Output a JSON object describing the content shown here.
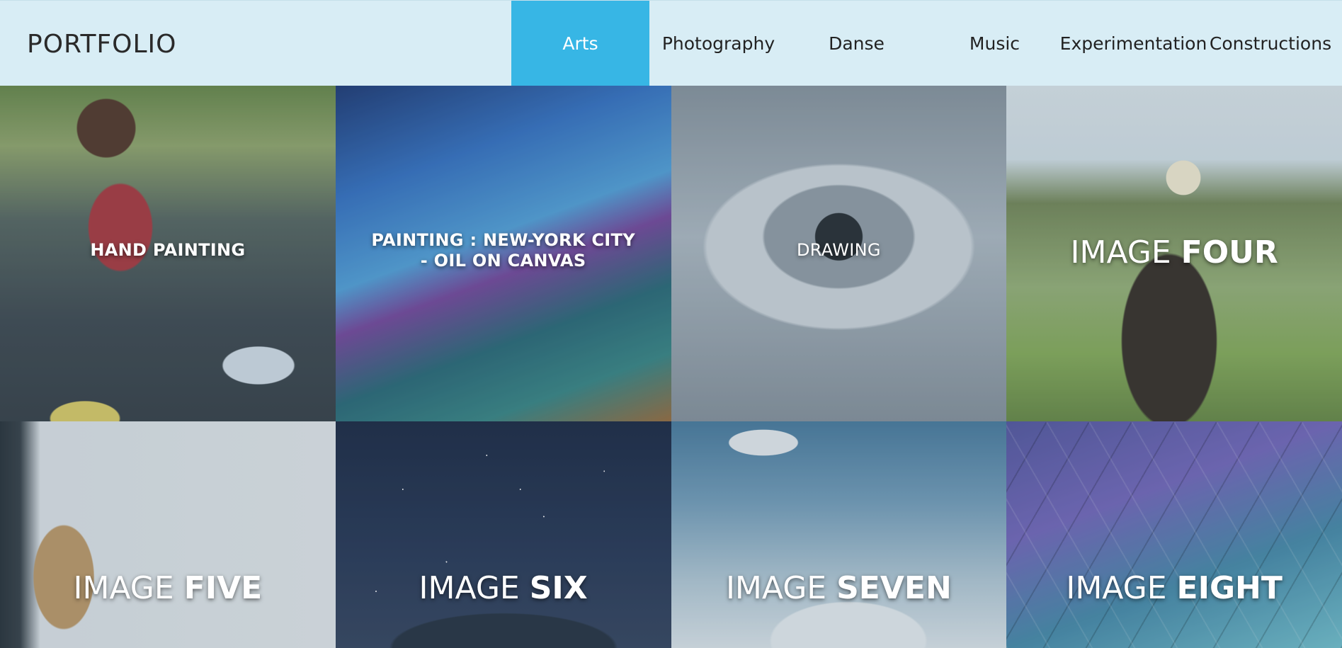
{
  "brand": {
    "title": "PORTFOLIO"
  },
  "nav": {
    "active": "Arts",
    "items": [
      {
        "label": "Arts"
      },
      {
        "label": "Photography"
      },
      {
        "label": "Danse"
      },
      {
        "label": "Music"
      },
      {
        "label": "Experimentation"
      },
      {
        "label": "Constructions"
      }
    ]
  },
  "tiles": [
    {
      "caption": "HAND PAINTING",
      "style": "small"
    },
    {
      "caption_line1": "PAINTING : NEW-YORK CITY",
      "caption_line2": "- OIL ON CANVAS",
      "style": "small"
    },
    {
      "caption": "DRAWING",
      "style": "small"
    },
    {
      "caption_light": "IMAGE",
      "caption_bold": "FOUR",
      "style": "big"
    },
    {
      "caption_light": "IMAGE",
      "caption_bold": "FIVE",
      "style": "big"
    },
    {
      "caption_light": "IMAGE",
      "caption_bold": "SIX",
      "style": "big"
    },
    {
      "caption_light": "IMAGE",
      "caption_bold": "SEVEN",
      "style": "big"
    },
    {
      "caption_light": "IMAGE",
      "caption_bold": "EIGHT",
      "style": "big"
    }
  ],
  "colors": {
    "header_bg": "#d8edf5",
    "active_tab_bg": "#37b6e5",
    "active_tab_text": "#ffffff",
    "nav_text": "#222222",
    "caption_text": "#ffffff"
  }
}
